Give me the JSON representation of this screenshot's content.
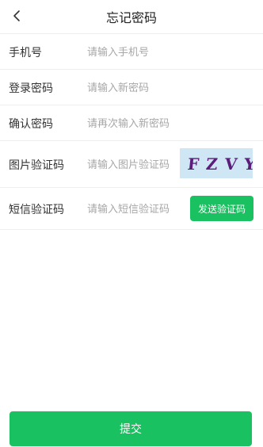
{
  "header": {
    "title": "忘记密码",
    "back_icon": "chevron-left-icon"
  },
  "form": {
    "phone": {
      "label": "手机号",
      "placeholder": "请输入手机号",
      "value": ""
    },
    "password": {
      "label": "登录密码",
      "placeholder": "请输入新密码",
      "value": ""
    },
    "confirm": {
      "label": "确认密码",
      "placeholder": "请再次输入新密码",
      "value": ""
    },
    "captcha": {
      "label": "图片验证码",
      "placeholder": "请输入图片验证码",
      "value": "",
      "image_text": "FZVY"
    },
    "sms": {
      "label": "短信验证码",
      "placeholder": "请输入短信验证码",
      "value": "",
      "button_label": "发送验证码"
    }
  },
  "submit_label": "提交",
  "colors": {
    "accent": "#19c160",
    "captcha_bg": "#cfe6f4",
    "captcha_text": "#5b1e7a",
    "divider": "#eeeeee",
    "placeholder": "#a7a7a7"
  }
}
